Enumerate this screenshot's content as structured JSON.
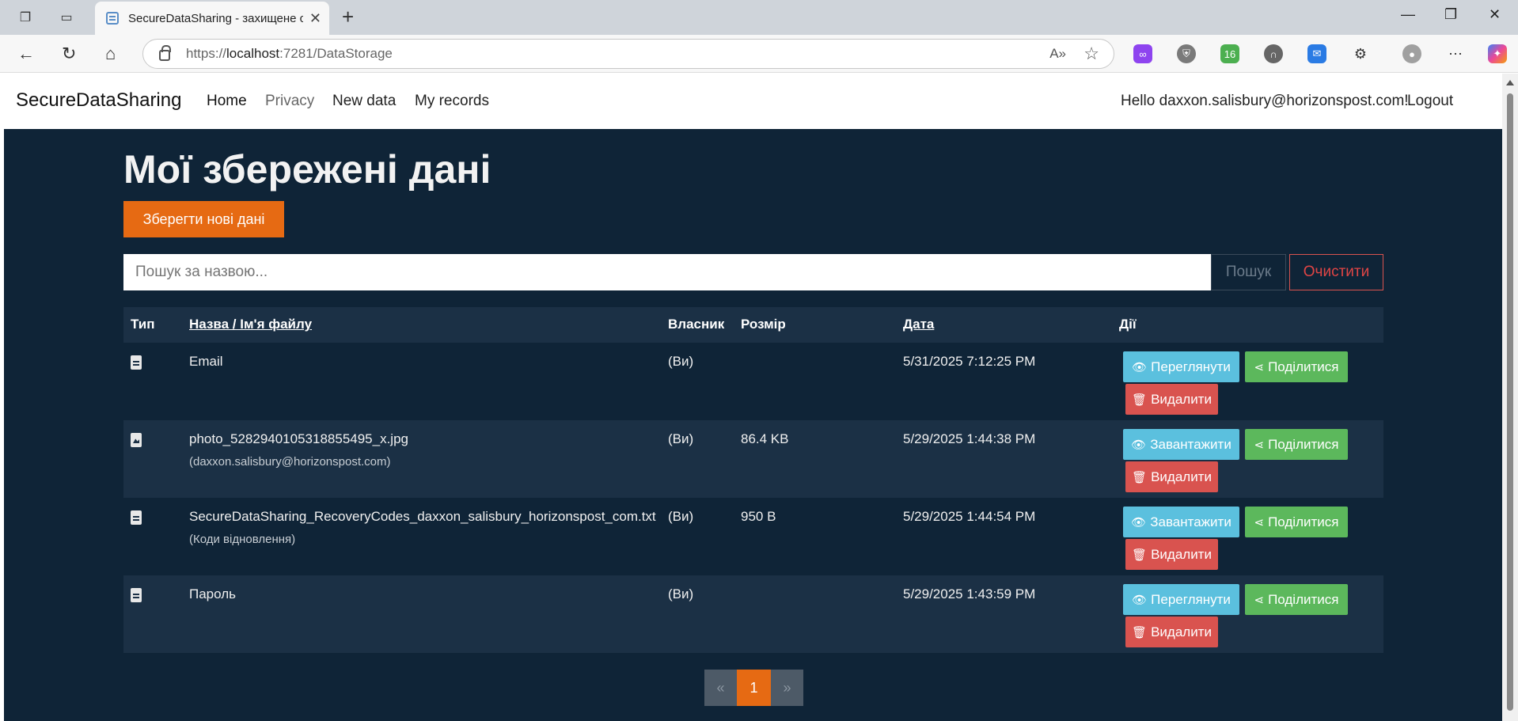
{
  "browser": {
    "tab_title": "SecureDataSharing - захищене сх",
    "url_prefix": "https://",
    "url_host": "localhost",
    "url_rest": ":7281/DataStorage"
  },
  "navbar": {
    "brand": "SecureDataSharing",
    "links": [
      "Home",
      "Privacy",
      "New data",
      "My records"
    ],
    "greeting": "Hello daxxon.salisbury@horizonspost.com!",
    "logout": "Logout"
  },
  "main": {
    "title": "Мої збережені дані",
    "new_button": "Зберегти нові дані",
    "search_placeholder": "Пошук за назвою...",
    "search_button": "Пошук",
    "clear_button": "Очистити"
  },
  "table": {
    "headers": {
      "type": "Тип",
      "name": "Назва / Ім'я файлу",
      "owner": "Власник",
      "size": "Розмір",
      "date": "Дата",
      "actions": "Дії"
    },
    "rows": [
      {
        "icon": "file-text-icon",
        "name": "Email",
        "sub": "",
        "owner": "(Ви)",
        "size": "",
        "date": "5/31/2025 7:12:25 PM",
        "primary_action": "Переглянути",
        "share": "Поділитися",
        "delete": "Видалити"
      },
      {
        "icon": "file-image-icon",
        "name": "photo_5282940105318855495_x.jpg",
        "sub": "(daxxon.salisbury@horizonspost.com)",
        "owner": "(Ви)",
        "size": "86.4 KB",
        "date": "5/29/2025 1:44:38 PM",
        "primary_action": "Завантажити",
        "share": "Поділитися",
        "delete": "Видалити"
      },
      {
        "icon": "file-text-icon",
        "name": "SecureDataSharing_RecoveryCodes_daxxon_salisbury_horizonspost_com.txt",
        "sub": "(Коди відновлення)",
        "owner": "(Ви)",
        "size": "950 B",
        "date": "5/29/2025 1:44:54 PM",
        "primary_action": "Завантажити",
        "share": "Поділитися",
        "delete": "Видалити"
      },
      {
        "icon": "file-text-icon",
        "name": "Пароль",
        "sub": "",
        "owner": "(Ви)",
        "size": "",
        "date": "5/29/2025 1:43:59 PM",
        "primary_action": "Переглянути",
        "share": "Поділитися",
        "delete": "Видалити"
      }
    ]
  },
  "pagination": {
    "prev": "«",
    "current": "1",
    "next": "»"
  },
  "colors": {
    "page_bg": "#0f2437",
    "accent": "#e66a13",
    "info": "#5bc0de",
    "success": "#5cb85c",
    "danger": "#d9534f"
  }
}
